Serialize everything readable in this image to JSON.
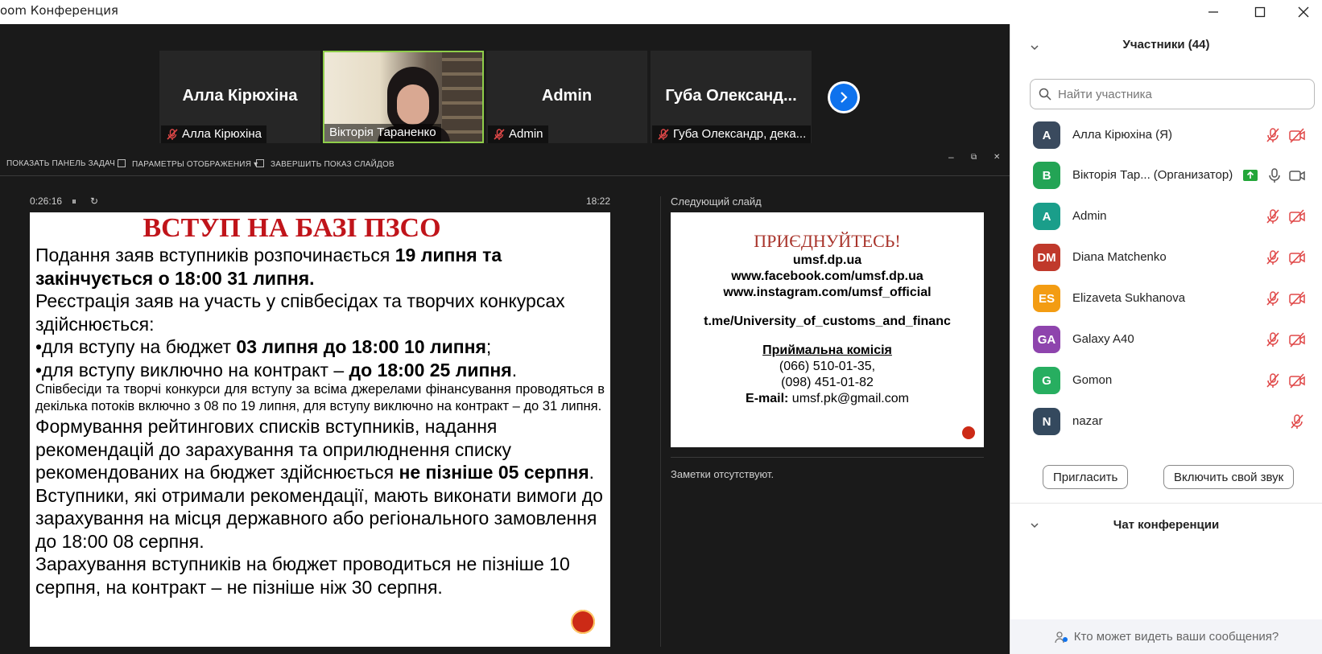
{
  "window": {
    "title": "oom Конференция",
    "minimize_icon": "minimize-icon",
    "maximize_icon": "maximize-icon",
    "close_icon": "close-icon"
  },
  "videos": [
    {
      "name": "Алла Кірюхіна",
      "label": "Алла Кірюхіна",
      "muted": true,
      "video": false
    },
    {
      "name": "Вікторія Тараненко",
      "label": "Вікторія Тараненко",
      "muted": false,
      "video": true
    },
    {
      "name": "Admin",
      "label": "Admin",
      "muted": true,
      "video": false
    },
    {
      "name": "Губа  Олександ...",
      "label": "Губа Олександр, дека...",
      "muted": true,
      "video": false
    }
  ],
  "presenter_toolbar": {
    "show_taskbar": "ПОКАЗАТЬ ПАНЕЛЬ ЗАДАЧ",
    "display_settings": "ПАРАМЕТРЫ ОТОБРАЖЕНИЯ ▾",
    "end_slideshow": "ЗАВЕРШИТЬ ПОКАЗ СЛАЙДОВ",
    "win_min": "–",
    "win_restore": "⧉",
    "win_close": "✕"
  },
  "slideshow": {
    "elapsed": "0:26:16",
    "pause": "⏸",
    "restart": "↻",
    "clock": "18:22",
    "next_slide_label": "Следующий слайд",
    "notes": "Заметки отсутствуют."
  },
  "slide": {
    "title": "ВСТУП НА БАЗІ ПЗСО",
    "p1_a": "Подання заяв вступників розпочинається ",
    "p1_b": "19 липня та закінчується о 18:00 31 липня.",
    "p2": "Реєстрація заяв на участь у співбесідах та творчих конкурсах здійснюється:",
    "p3_a": "•для вступу на бюджет ",
    "p3_b": "03 липня до 18:00 10 липня",
    "p3_c": ";",
    "p4_a": "•для вступу виключно на контракт – ",
    "p4_b": "до 18:00 25 липня",
    "p4_c": ".",
    "p5": "Співбесіди та творчі конкурси для вступу за всіма джерелами фінансування проводяться в декілька потоків включно з 08 по 19 липня, для вступу виключно на контракт – до 31 липня.",
    "p6_a": "Формування рейтингових списків вступників, надання рекомендацій до зарахування та оприлюднення списку рекомендованих на бюджет здійснюється ",
    "p6_b": "не пізніше 05 серпня",
    "p6_c": ".",
    "p7": "Вступники, які отримали рекомендації, мають виконати вимоги до зарахування на місця державного або регіонального замовлення до 18:00 08 серпня.",
    "p8": "Зарахування вступників на бюджет проводиться не пізніше 10 серпня, на контракт – не пізніше ніж 30 серпня."
  },
  "next_slide": {
    "title": "ПРИЄДНУЙТЕСЬ!",
    "line1": "umsf.dp.ua",
    "line2": "www.facebook.com/umsf.dp.ua",
    "line3": "www.instagram.com/umsf_official",
    "line4": "t.me/University_of_customs_and_financ",
    "committee": "Приймальна комісія",
    "phone1": "(066) 510-01-35,",
    "phone2": "(098) 451-01-82",
    "email_label": "E-mail:",
    "email": " umsf.pk@gmail.com"
  },
  "participants": {
    "header": "Участники (44)",
    "search_placeholder": "Найти участника",
    "list": [
      {
        "initials": "A",
        "name": "Алла Кірюхіна (Я)",
        "role": "",
        "color": "#3a4a5e",
        "muted": true,
        "video_off": true
      },
      {
        "initials": "В",
        "name": "Вікторія Тар...",
        "role": "(Организатор)",
        "color": "#23a455",
        "muted": false,
        "video_off": false
      },
      {
        "initials": "A",
        "name": "Admin",
        "role": "",
        "color": "#1a9e8a",
        "muted": true,
        "video_off": true
      },
      {
        "initials": "DM",
        "name": "Diana Matchenko",
        "role": "",
        "color": "#c0392b",
        "muted": true,
        "video_off": true
      },
      {
        "initials": "ES",
        "name": "Elizaveta Sukhanova",
        "role": "",
        "color": "#f39c12",
        "muted": true,
        "video_off": true
      },
      {
        "initials": "GA",
        "name": "Galaxy A40",
        "role": "",
        "color": "#8e44ad",
        "muted": true,
        "video_off": true
      },
      {
        "initials": "G",
        "name": "Gomon",
        "role": "",
        "color": "#27ae60",
        "muted": true,
        "video_off": true
      },
      {
        "initials": "N",
        "name": "nazar",
        "role": "",
        "color": "#34495e",
        "muted": true,
        "video_off": false
      }
    ],
    "invite": "Пригласить",
    "unmute": "Включить свой звук"
  },
  "chat": {
    "header": "Чат конференции",
    "footer": "Кто может видеть ваши сообщения?"
  },
  "colors": {
    "accent_blue": "#0e72ed",
    "muted_red": "#e04848",
    "active_speaker": "#8fce4a",
    "slide_title_red": "#c0141a"
  }
}
